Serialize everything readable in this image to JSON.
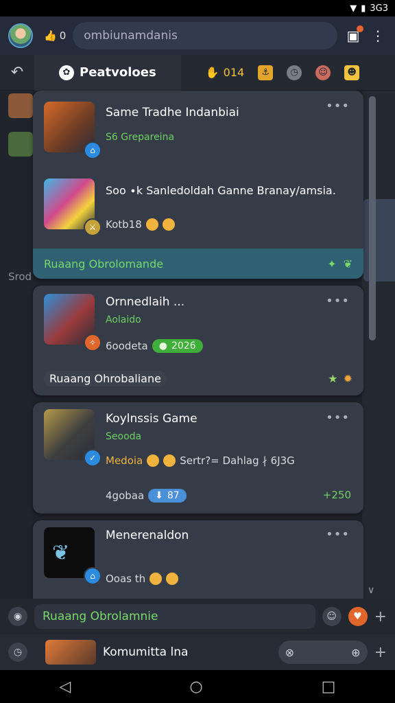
{
  "status": {
    "time": "3G3"
  },
  "header": {
    "likes": "0",
    "search_placeholder": "ombiunamdanis"
  },
  "tabs": {
    "back_icon": "back-arrow-icon",
    "active_label": "Peatvoloes",
    "coins": "014"
  },
  "left_strip": {
    "text": "Srod"
  },
  "cards": [
    {
      "rows": [
        {
          "title": "Same Tradhe Indanbiai",
          "sub": "S6 Grepareina"
        },
        {
          "title": "Soo ∙k Sanledoldah Ganne Branay∕amsia.",
          "meta": "Kotb18"
        }
      ],
      "footer": "Ruaang Obrolomande"
    },
    {
      "rows": [
        {
          "title": "Ornnedlaih ...",
          "sub": "Aolaido",
          "meta": "6oodeta",
          "pill": "2026"
        }
      ],
      "footer": "Ruaang Ohrobaliane"
    },
    {
      "rows": [
        {
          "title": "Koylnssis Game",
          "sub": "Seooda",
          "meta_left": "Medoia",
          "meta_right": "Sertr?= Dahlag ∤ 6J3G",
          "count_label": "4gobaa",
          "count_value": "87",
          "delta": "+250"
        }
      ]
    },
    {
      "rows": [
        {
          "title": "Menerenaldon",
          "meta": "Ooas th"
        }
      ]
    }
  ],
  "bottom_chat": {
    "label": "Ruaang Obrolamnie"
  },
  "peek_item": {
    "title": "Komumitta lna"
  },
  "colors": {
    "accent": "#6fcf64",
    "appbar": "#262b3c",
    "card": "#363c47"
  }
}
